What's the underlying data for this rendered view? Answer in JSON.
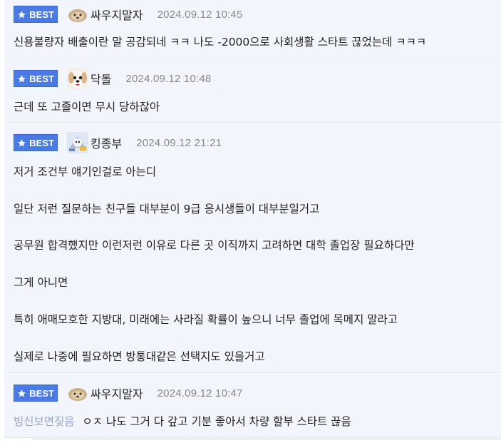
{
  "best_label": "BEST",
  "comments": [
    {
      "nick": "싸우지말자",
      "time": "2024.09.12 10:45",
      "avatar": "dog-avatar-icon",
      "lines": [
        "신용불량자 배출이란 말 공감되네 ㅋㅋ 나도 -2000으로 사회생활 스타트 끊었는데 ㅋㅋㅋ"
      ]
    },
    {
      "nick": "닥돌",
      "time": "2024.09.12 10:48",
      "avatar": "puppy-avatar-icon",
      "lines": [
        "근데 또 고졸이면 무시 당하잖아"
      ]
    },
    {
      "nick": "킹종부",
      "time": "2024.09.12 21:21",
      "avatar": "game-avatar-icon",
      "lines": [
        "저거 조건부 얘기인걸로 아는디",
        "일단 저런 질문하는 친구들 대부분이 9급 응시생들이 대부분일거고",
        "공무원 합격했지만 이런저런 이유로 다른 곳 이직까지 고려하면 대학 졸업장 필요하다만",
        "그게 아니면",
        "특히 애매모호한 지방대, 미래에는 사라질 확률이 높으니 너무 졸업에 목메지 말라고",
        "실제로 나중에 필요하면 방통대같은 선택지도 있을거고"
      ]
    },
    {
      "nick": "싸우지말자",
      "time": "2024.09.12 10:47",
      "avatar": "dog-avatar-icon",
      "quote_name": "빙신보면짖음",
      "lines": [
        "ㅇㅈ 나도 그거 다 갚고 기분 좋아서 차량 할부 스타트 끊음"
      ]
    }
  ],
  "colors": {
    "best_badge": "#4a7be5",
    "comment_bg": "#f2f5fc",
    "quote_name": "#9aa6c7",
    "timestamp": "#888888"
  }
}
